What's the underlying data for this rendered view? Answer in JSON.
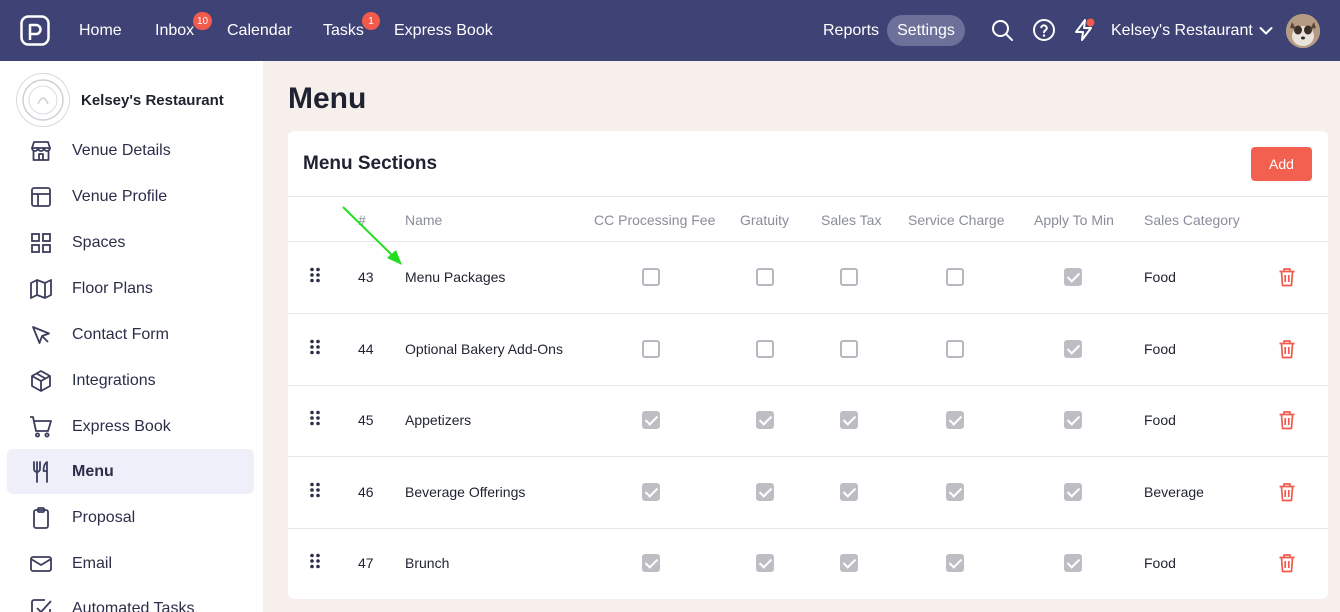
{
  "topnav": {
    "items": [
      {
        "label": "Home",
        "badge": ""
      },
      {
        "label": "Inbox",
        "badge": "10"
      },
      {
        "label": "Calendar",
        "badge": ""
      },
      {
        "label": "Tasks",
        "badge": "1"
      },
      {
        "label": "Express Book",
        "badge": ""
      }
    ],
    "reports": "Reports",
    "settings": "Settings",
    "account": "Kelsey's Restaurant"
  },
  "sidebar": {
    "venue_name": "Kelsey's Restaurant",
    "items": [
      {
        "label": "Venue Details",
        "icon": "store-icon"
      },
      {
        "label": "Venue Profile",
        "icon": "layout-icon"
      },
      {
        "label": "Spaces",
        "icon": "grid-icon"
      },
      {
        "label": "Floor Plans",
        "icon": "map-icon"
      },
      {
        "label": "Contact Form",
        "icon": "cursor-icon"
      },
      {
        "label": "Integrations",
        "icon": "cube-icon"
      },
      {
        "label": "Express Book",
        "icon": "cart-icon"
      },
      {
        "label": "Menu",
        "icon": "utensils-icon",
        "active": true
      },
      {
        "label": "Proposal",
        "icon": "clipboard-icon"
      },
      {
        "label": "Email",
        "icon": "mail-icon"
      },
      {
        "label": "Automated Tasks",
        "icon": "check-square-icon"
      }
    ]
  },
  "main": {
    "title": "Menu",
    "card_title": "Menu Sections",
    "add_label": "Add",
    "columns": [
      "#",
      "Name",
      "CC Processing Fee",
      "Gratuity",
      "Sales Tax",
      "Service Charge",
      "Apply To Min",
      "Sales Category"
    ],
    "rows": [
      {
        "num": "43",
        "name": "Menu Packages",
        "cc": false,
        "gratuity": false,
        "tax": false,
        "service": false,
        "apply": true,
        "category": "Food"
      },
      {
        "num": "44",
        "name": "Optional Bakery Add-Ons",
        "cc": false,
        "gratuity": false,
        "tax": false,
        "service": false,
        "apply": true,
        "category": "Food"
      },
      {
        "num": "45",
        "name": "Appetizers",
        "cc": true,
        "gratuity": true,
        "tax": true,
        "service": true,
        "apply": true,
        "category": "Food"
      },
      {
        "num": "46",
        "name": "Beverage Offerings",
        "cc": true,
        "gratuity": true,
        "tax": true,
        "service": true,
        "apply": true,
        "category": "Beverage"
      },
      {
        "num": "47",
        "name": "Brunch",
        "cc": true,
        "gratuity": true,
        "tax": true,
        "service": true,
        "apply": true,
        "category": "Food"
      }
    ]
  },
  "colors": {
    "nav": "#3f4275",
    "accent": "#f4604f",
    "annotation": "#22dd22"
  }
}
